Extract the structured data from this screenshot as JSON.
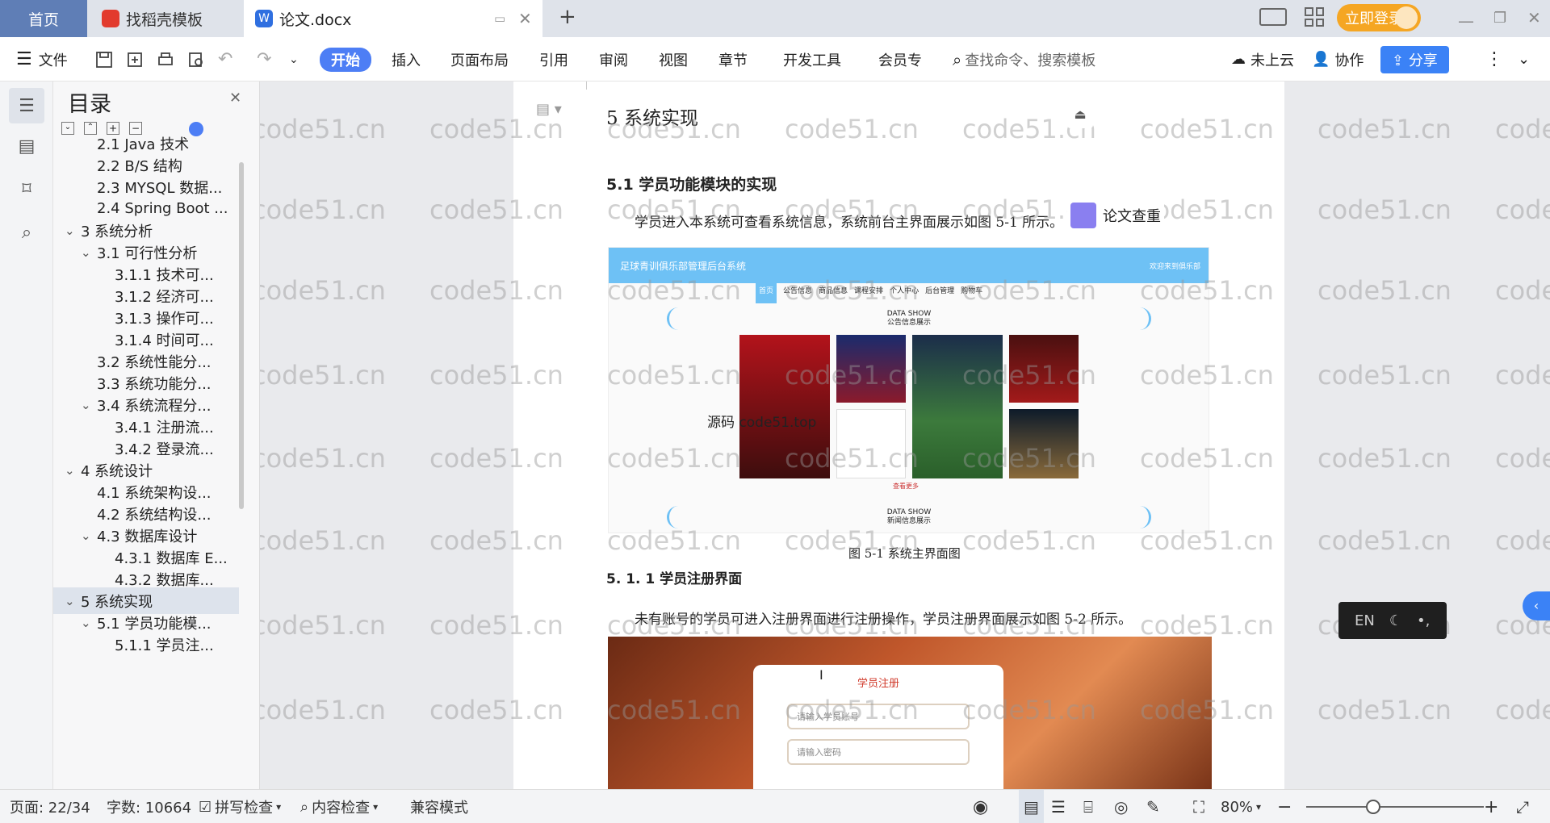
{
  "tabs": {
    "home": "首页",
    "template": "找稻壳模板",
    "doc": "论文.docx",
    "login": "立即登录"
  },
  "menu": {
    "file": "文件",
    "items": [
      "开始",
      "插入",
      "页面布局",
      "引用",
      "审阅",
      "视图",
      "章节",
      "开发工具",
      "会员专"
    ],
    "search_placeholder": "查找命令、搜索模板",
    "cloud": "未上云",
    "collab": "协作",
    "share": "分享"
  },
  "toc": {
    "title": "目录",
    "items": [
      {
        "label": "2.1 Java 技术",
        "level": 2,
        "chev": ""
      },
      {
        "label": "2.2 B/S 结构",
        "level": 2,
        "chev": ""
      },
      {
        "label": "2.3 MYSQL 数据...",
        "level": 2,
        "chev": ""
      },
      {
        "label": "2.4 Spring Boot ...",
        "level": 2,
        "chev": ""
      },
      {
        "label": "3  系统分析",
        "level": 1,
        "chev": "v"
      },
      {
        "label": "3.1  可行性分析",
        "level": 2,
        "chev": "v"
      },
      {
        "label": "3.1.1  技术可...",
        "level": 3,
        "chev": ""
      },
      {
        "label": "3.1.2  经济可...",
        "level": 3,
        "chev": ""
      },
      {
        "label": "3.1.3  操作可...",
        "level": 3,
        "chev": ""
      },
      {
        "label": "3.1.4  时间可...",
        "level": 3,
        "chev": ""
      },
      {
        "label": "3.2  系统性能分...",
        "level": 2,
        "chev": ""
      },
      {
        "label": "3.3  系统功能分...",
        "level": 2,
        "chev": ""
      },
      {
        "label": "3.4  系统流程分...",
        "level": 2,
        "chev": "v"
      },
      {
        "label": "3.4.1 注册流...",
        "level": 3,
        "chev": ""
      },
      {
        "label": "3.4.2 登录流...",
        "level": 3,
        "chev": ""
      },
      {
        "label": "4  系统设计",
        "level": 1,
        "chev": "v"
      },
      {
        "label": "4.1  系统架构设...",
        "level": 2,
        "chev": ""
      },
      {
        "label": "4.2  系统结构设...",
        "level": 2,
        "chev": ""
      },
      {
        "label": "4.3  数据库设计",
        "level": 2,
        "chev": "v"
      },
      {
        "label": "4.3.1 数据库 E...",
        "level": 3,
        "chev": ""
      },
      {
        "label": "4.3.2 数据库...",
        "level": 3,
        "chev": ""
      },
      {
        "label": "5  系统实现",
        "level": 1,
        "chev": "v",
        "selected": true
      },
      {
        "label": "5.1  学员功能模...",
        "level": 2,
        "chev": "v"
      },
      {
        "label": "5.1.1 学员注...",
        "level": 3,
        "chev": ""
      }
    ]
  },
  "doc": {
    "h1": "5  系统实现",
    "h2": "5.1  学员功能模块的实现",
    "p1": "学员进入本系统可查看系统信息，系统前台主界面展示如图 5-1 所示。",
    "fig1_header": "足球青训俱乐部管理后台系统",
    "fig1_header_right": "欢迎来到俱乐部",
    "fig1_nav": [
      "首页",
      "公告信息",
      "商品信息",
      "课程安排",
      "个人中心",
      "后台管理",
      "购物车"
    ],
    "fig1_data_show": "DATA SHOW",
    "fig1_notice": "公告信息展示",
    "fig1_more": "查看更多",
    "fig1_news": "新闻信息展示",
    "fig1_overlay": "源码   code51.top",
    "caption1": "图 5-1 系统主界面图",
    "h3": "5. 1. 1 学员注册界面",
    "p2": "未有账号的学员可进入注册界面进行注册操作，学员注册界面展示如图 5-2 所示。",
    "reg_title": "学员注册",
    "reg_account": "请输入学员账号",
    "reg_password": "请输入密码"
  },
  "right": {
    "check_label": "论文查重",
    "en_label": "EN"
  },
  "status": {
    "page": "页面: 22/34",
    "words": "字数: 10664",
    "spell": "拼写检查",
    "content_check": "内容检查",
    "compat": "兼容模式",
    "zoom": "80%"
  },
  "watermark": "code51.cn",
  "colors": {
    "accent": "#4d7ef5",
    "login": "#f5a623",
    "tab_home": "#5f7eb6"
  }
}
